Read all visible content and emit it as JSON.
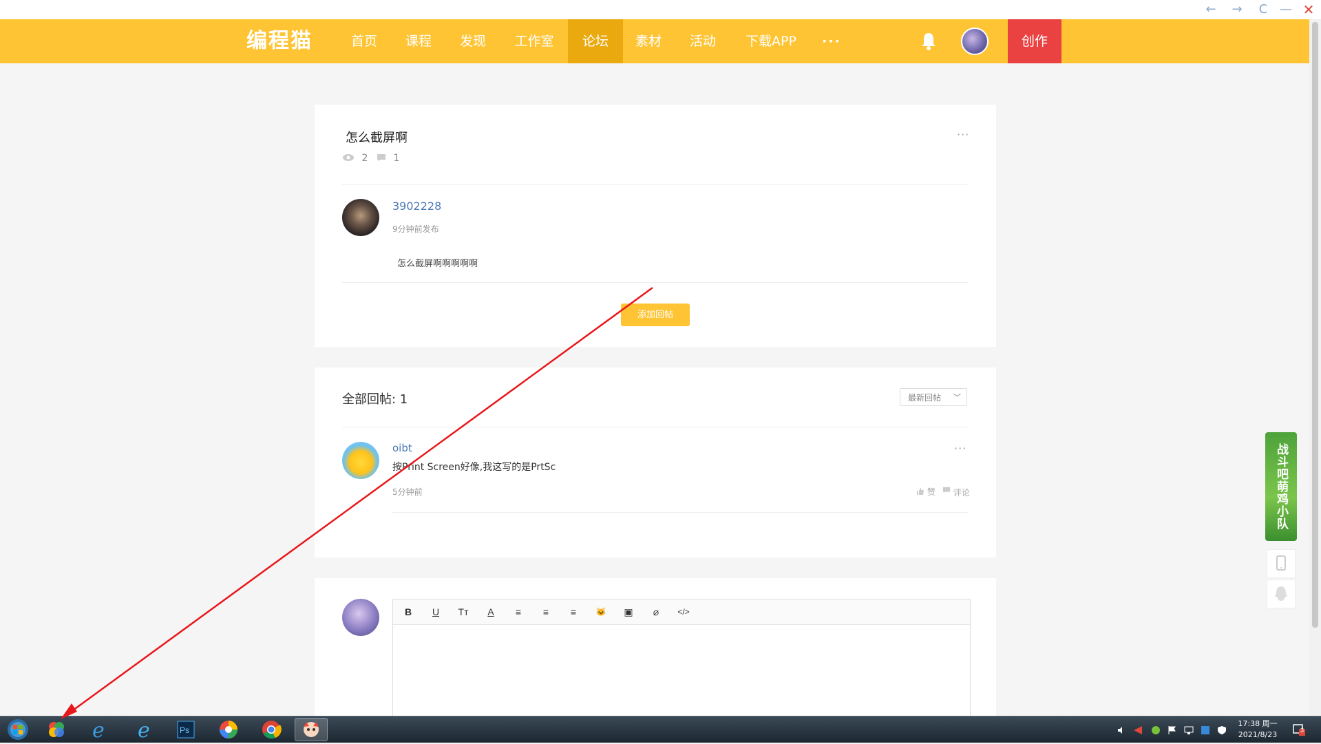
{
  "window": {
    "back_label": "←",
    "forward_label": "→",
    "refresh_label": "C",
    "minimize_label": "—",
    "close_label": "✕"
  },
  "nav": {
    "brand": "编程猫",
    "items": [
      {
        "label": "首页",
        "active": false
      },
      {
        "label": "课程",
        "active": false
      },
      {
        "label": "发现",
        "active": false
      },
      {
        "label": "工作室",
        "active": false
      },
      {
        "label": "论坛",
        "active": true
      },
      {
        "label": "素材",
        "active": false
      },
      {
        "label": "活动",
        "active": false
      },
      {
        "label": "下载APP",
        "active": false
      }
    ],
    "more_label": "···",
    "create_label": "创作"
  },
  "post": {
    "title": "怎么截屏啊",
    "more_label": "···",
    "views": "2",
    "comments": "1",
    "author": "3902228",
    "time": "9分钟前发布",
    "body": "怎么截屏啊啊啊啊啊",
    "add_reply_label": "添加回帖"
  },
  "replies": {
    "title": "全部回帖: 1",
    "sort_label": "最新回帖",
    "items": [
      {
        "user": "oibt",
        "body": "按Print Screen好像,我这写的是PrtSc",
        "time": "5分钟前",
        "like_label": "赞",
        "comment_label": "评论",
        "more_label": "···"
      }
    ]
  },
  "editor": {
    "toolbar": [
      "B",
      "U",
      "Tт",
      "A",
      "≡",
      "≡",
      "≡",
      "🐱",
      "▣",
      "⌀",
      "</>"
    ]
  },
  "side": {
    "banner_text": "战斗吧萌鸡小队"
  },
  "taskbar": {
    "time": "17:38 周一",
    "date": "2021/8/23",
    "notification_count": "3"
  },
  "colors": {
    "brand": "#fec433",
    "brand_active": "#e9a90f",
    "create": "#ea4141",
    "link": "#4a78b5",
    "annotation": "#e8171b"
  }
}
